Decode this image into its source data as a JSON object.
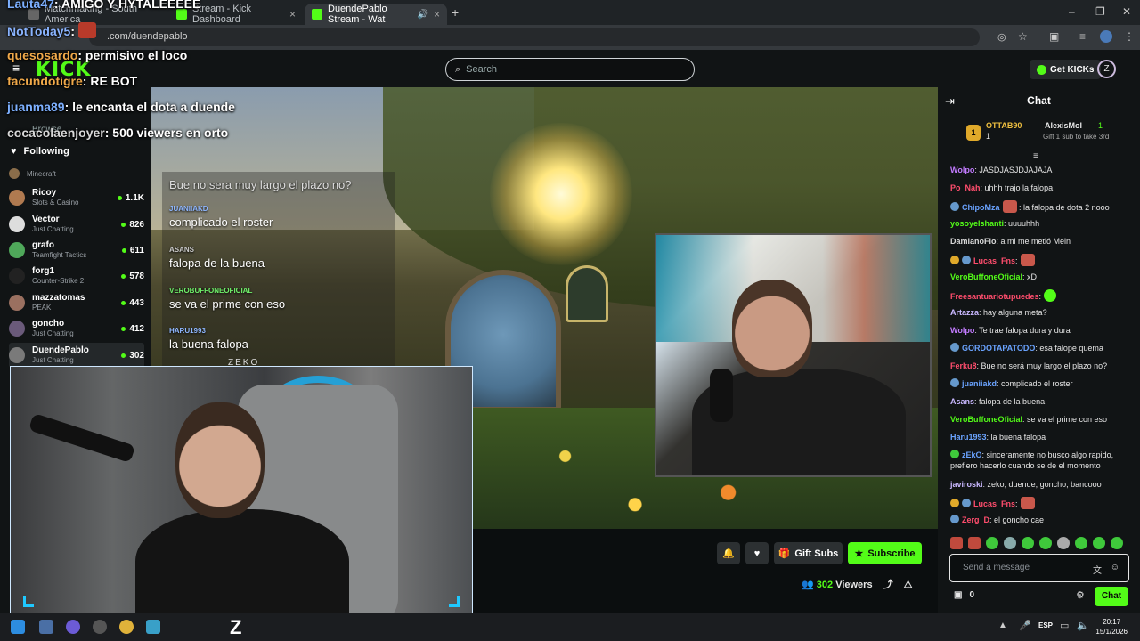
{
  "browser": {
    "tabs": [
      {
        "label": "Matchmaking - South America",
        "active": false
      },
      {
        "label": "Stream - Kick Dashboard",
        "active": false
      },
      {
        "label": "DuendePablo Stream - Wat",
        "active": true
      }
    ],
    "url": ".com/duendepablo"
  },
  "kick": {
    "logo": "KICK",
    "search_placeholder": "Search",
    "get_kicks": "Get KICKs",
    "avatar": "Z"
  },
  "overlay_chat": [
    {
      "user": "Lauta47",
      "text": ": AMIGO Y HYTALEEEEE",
      "color": "#7db0ff"
    },
    {
      "user": "NotToday5",
      "text": ":",
      "color": "#8ab4ff"
    },
    {
      "user": "quesosardo",
      "text": ": permisivo el loco",
      "color": "#f0a94a"
    },
    {
      "user": "facundotigre",
      "text": ": RE BOT",
      "color": "#f0a94a"
    },
    {
      "user": "juanma89",
      "text": ": le encanta el dota a duende",
      "color": "#7db0ff"
    },
    {
      "user": "cocacolaenjoyer",
      "text": ": 500 viewers en orto",
      "color": "#d8d8d8"
    }
  ],
  "sidebar": {
    "following_label": "Following",
    "browse_label": "Browse",
    "channels": [
      {
        "name": "",
        "category": "Minecraft",
        "viewers": ""
      },
      {
        "name": "Ricoy",
        "category": "Slots & Casino",
        "viewers": "1.1K"
      },
      {
        "name": "Vector",
        "category": "Just Chatting",
        "viewers": "826"
      },
      {
        "name": "grafo",
        "category": "Teamfight Tactics",
        "viewers": "611"
      },
      {
        "name": "forg1",
        "category": "Counter-Strike 2",
        "viewers": "578"
      },
      {
        "name": "mazzatomas",
        "category": "PEAK",
        "viewers": "443"
      },
      {
        "name": "goncho",
        "category": "Just Chatting",
        "viewers": "412"
      },
      {
        "name": "DuendePablo",
        "category": "Just Chatting",
        "viewers": "302"
      }
    ]
  },
  "video_chat": [
    {
      "user": "",
      "text": "Bue no sera muy largo el plazo no?"
    },
    {
      "user": "JUANIIAKD",
      "text": "complicado el roster"
    },
    {
      "user": "ASANS",
      "text": "falopa de la buena"
    },
    {
      "user": "VEROBUFFONEOFICIAL",
      "text": "se va el prime con eso"
    },
    {
      "user": "HARU1993",
      "text": "la buena falopa"
    }
  ],
  "video_watermark": "ZEKO",
  "actions": {
    "gift_subs": "Gift Subs",
    "subscribe": "Subscribe",
    "viewers_count": "302",
    "viewers_label": "Viewers"
  },
  "chat": {
    "title": "Chat",
    "pinned": {
      "rank": "1",
      "top_user": "OTTAB90",
      "top_count": "1",
      "second_user": "AlexisMol",
      "second_count": "1",
      "gift_hint": "Gift 1 sub to take 3rd"
    },
    "messages": [
      {
        "user": "Wolpo",
        "text": ": JASDJASJDJAJAJA",
        "color": "#c27bff"
      },
      {
        "user": "Po_Nah",
        "text": ": uhhh trajo la falopa",
        "color": "#ff4d6d"
      },
      {
        "user": "ChipoMza",
        "text": ": la falopa de dota 2 nooo",
        "color": "#6aa3ff"
      },
      {
        "user": "yosoyelshanti",
        "text": ": uuuuhhh",
        "color": "#53fc18"
      },
      {
        "user": "DamianoFlo",
        "text": ": a mi me metió Mein",
        "color": "#d8d8d8"
      },
      {
        "user": "Lucas_Fns",
        "text": ":",
        "color": "#ff4d6d"
      },
      {
        "user": "VeroBuffoneOficial",
        "text": ": xD",
        "color": "#53fc18"
      },
      {
        "user": "Freesantuariotupuedes",
        "text": ":",
        "color": "#ff4d6d"
      },
      {
        "user": "Artazza",
        "text": ": hay alguna meta?",
        "color": "#c9b8ff"
      },
      {
        "user": "Wolpo",
        "text": ": Te trae falopa dura y dura",
        "color": "#c27bff"
      },
      {
        "user": "GORDOTAPATODO",
        "text": ": esa falope quema",
        "color": "#6aa3ff"
      },
      {
        "user": "Ferku8",
        "text": ": Bue no será muy largo el plazo no?",
        "color": "#ff4d6d"
      },
      {
        "user": "juaniiakd",
        "text": ": complicado el roster",
        "color": "#6aa3ff"
      },
      {
        "user": "Asans",
        "text": ": falopa de la buena",
        "color": "#c9b8ff"
      },
      {
        "user": "VeroBuffoneOficial",
        "text": ": se va el prime con eso",
        "color": "#53fc18"
      },
      {
        "user": "Haru1993",
        "text": ": la buena falopa",
        "color": "#6aa3ff"
      },
      {
        "user": "zEkO",
        "text": ": sinceramente no busco algo rapido, prefiero hacerlo cuando se de el momento",
        "color": "#6aa3ff"
      },
      {
        "user": "javiroski",
        "text": ": zeko, duende, goncho, bancooo",
        "color": "#c9b8ff"
      },
      {
        "user": "Lucas_Fns",
        "text": ":",
        "color": "#ff4d6d"
      },
      {
        "user": "Zerg_D",
        "text": ": el goncho cae",
        "color": "#ff4d6d"
      }
    ],
    "input_placeholder": "Send a message",
    "points": "0",
    "send_label": "Chat"
  },
  "taskbar": {
    "lang": "ESP",
    "time": "20:17",
    "date": "15/1/2026"
  }
}
